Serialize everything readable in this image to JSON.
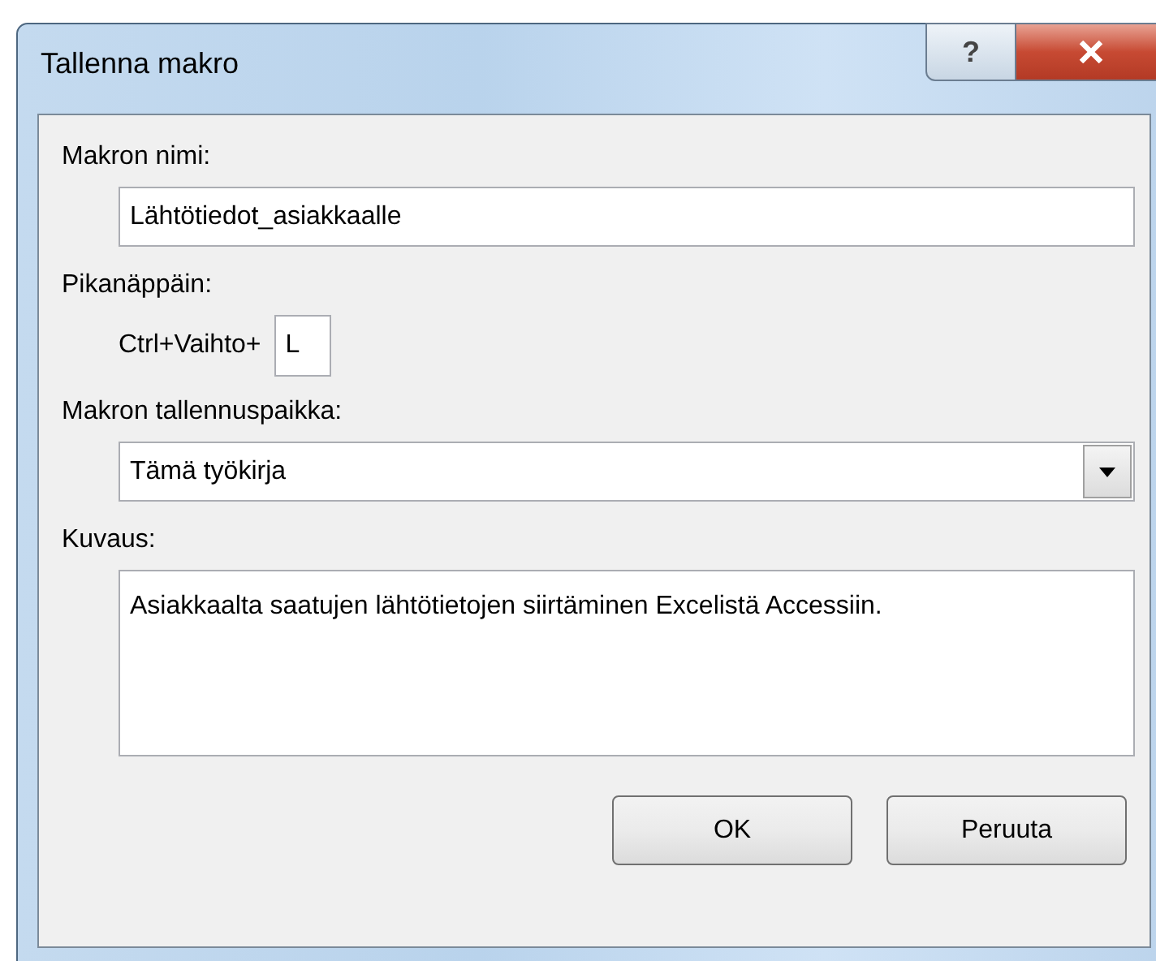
{
  "window": {
    "title": "Tallenna makro",
    "help_button": "?"
  },
  "macro_name": {
    "label": "Makron nimi:",
    "value": "Lähtötiedot_asiakkaalle"
  },
  "shortcut": {
    "label": "Pikanäppäin:",
    "prefix": "Ctrl+Vaihto+",
    "value": "L"
  },
  "store_in": {
    "label": "Makron tallennuspaikka:",
    "value": "Tämä työkirja"
  },
  "description": {
    "label": "Kuvaus:",
    "value": "Asiakkaalta saatujen lähtötietojen siirtäminen Excelistä Accessiin."
  },
  "buttons": [
    {
      "label": "OK"
    },
    {
      "label": "Peruuta"
    }
  ]
}
